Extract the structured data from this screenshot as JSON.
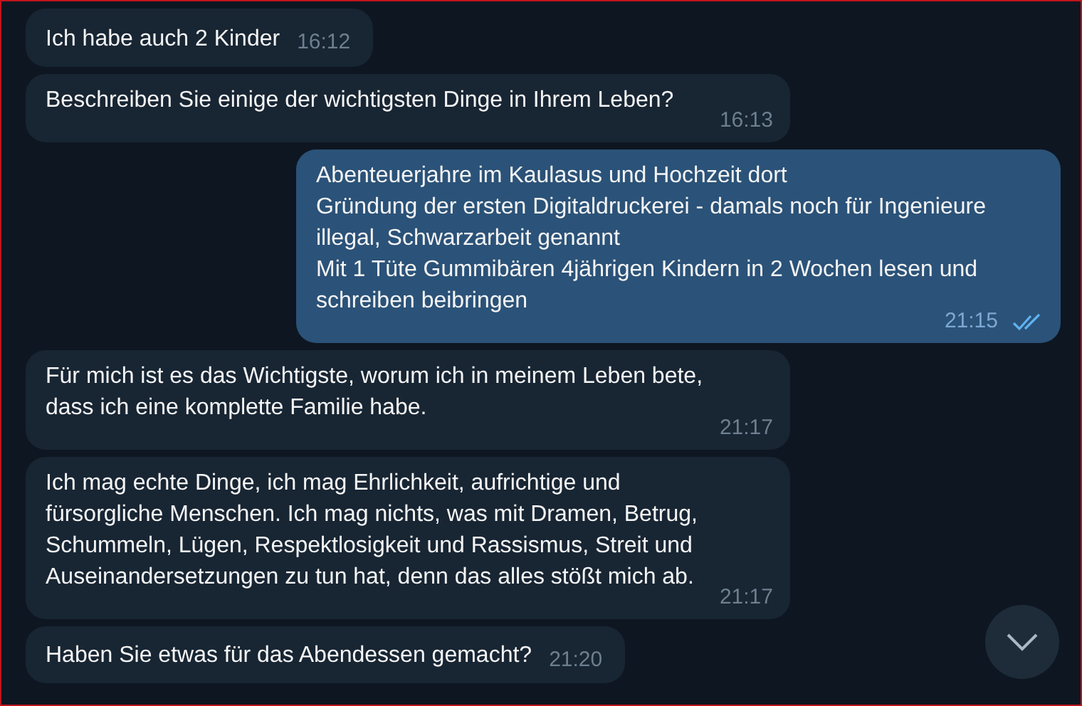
{
  "messages": [
    {
      "outgoing": false,
      "kind": "inline",
      "text": "Ich habe auch 2 Kinder",
      "time": "16:12"
    },
    {
      "outgoing": false,
      "kind": "stacked",
      "text": "Beschreiben Sie einige der wichtigsten Dinge in Ihrem Leben?",
      "time": "16:13"
    },
    {
      "outgoing": true,
      "kind": "stacked",
      "text": "Abenteuerjahre im Kaulasus und Hochzeit dort\nGründung der ersten Digitaldruckerei - damals noch für Ingenieure\nillegal, Schwarzarbeit genannt\nMit 1 Tüte Gummibären 4jährigen Kindern in 2 Wochen lesen und\nschreiben beibringen",
      "time": "21:15",
      "read": true
    },
    {
      "outgoing": false,
      "kind": "stacked",
      "text": "Für mich ist es das Wichtigste, worum ich in meinem Leben bete,\ndass ich eine komplette Familie habe.",
      "time": "21:17"
    },
    {
      "outgoing": false,
      "kind": "stacked",
      "text": "Ich mag echte Dinge, ich mag Ehrlichkeit, aufrichtige und\nfürsorgliche Menschen. Ich mag nichts, was mit Dramen, Betrug,\nSchummeln, Lügen, Respektlosigkeit und Rassismus, Streit und\nAuseinandersetzungen zu tun hat, denn das alles stößt mich ab.",
      "time": "21:17"
    },
    {
      "outgoing": false,
      "kind": "inline",
      "text": "Haben Sie etwas für das Abendessen gemacht?",
      "time": "21:20"
    }
  ]
}
